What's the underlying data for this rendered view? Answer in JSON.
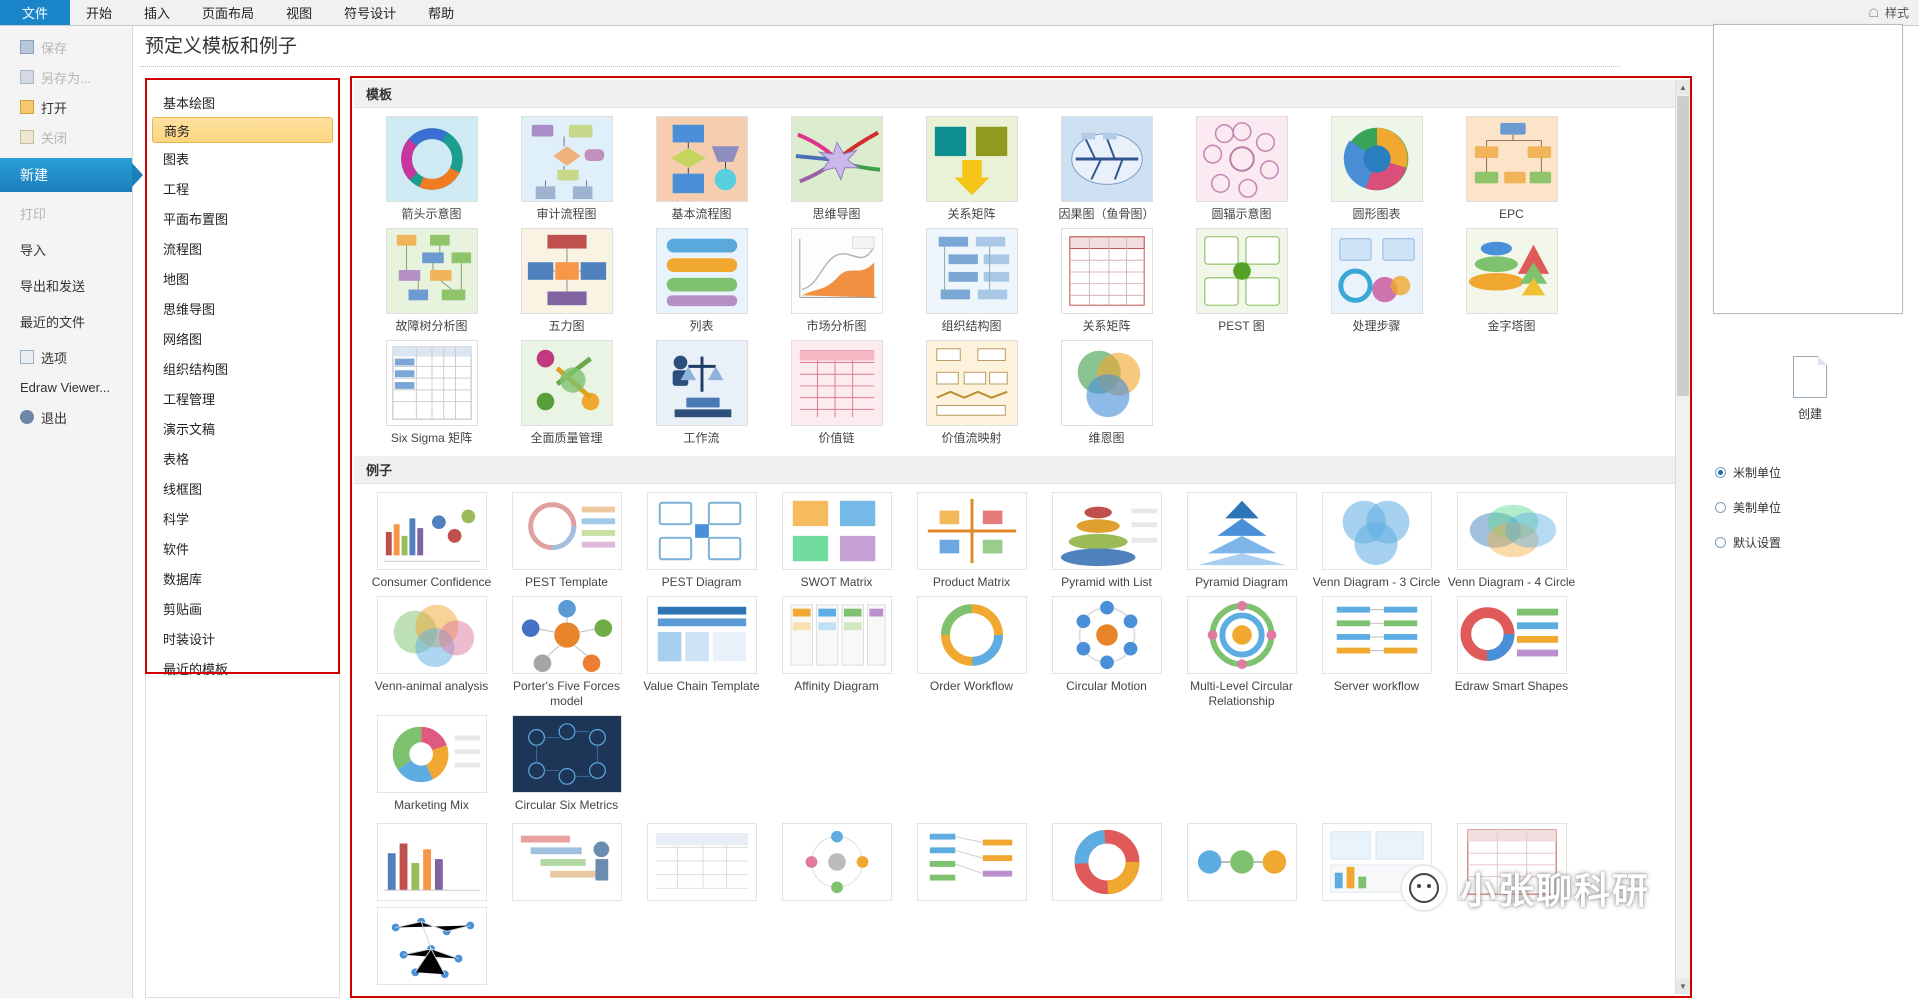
{
  "ribbon": {
    "tabs": [
      {
        "label": "文件",
        "active": true
      },
      {
        "label": "开始",
        "active": false
      },
      {
        "label": "插入",
        "active": false
      },
      {
        "label": "页面布局",
        "active": false
      },
      {
        "label": "视图",
        "active": false
      },
      {
        "label": "符号设计",
        "active": false
      },
      {
        "label": "帮助",
        "active": false
      }
    ],
    "right": {
      "style_label": "样式",
      "home_icon": "home-icon"
    }
  },
  "backstage": {
    "items": [
      {
        "label": "保存",
        "icon": "save-icon",
        "state": "disabled"
      },
      {
        "label": "另存为...",
        "icon": "save-as-icon",
        "state": "disabled"
      },
      {
        "label": "打开",
        "icon": "open-folder-icon",
        "state": "normal"
      },
      {
        "label": "关闭",
        "icon": "close-folder-icon",
        "state": "disabled"
      },
      {
        "label": "新建",
        "icon": "",
        "state": "selected"
      },
      {
        "label": "打印",
        "icon": "",
        "state": "disabled"
      },
      {
        "label": "导入",
        "icon": "",
        "state": "normal"
      },
      {
        "label": "导出和发送",
        "icon": "",
        "state": "normal"
      },
      {
        "label": "最近的文件",
        "icon": "",
        "state": "normal"
      },
      {
        "label": "选项",
        "icon": "options-icon",
        "state": "normal"
      },
      {
        "label": "Edraw Viewer...",
        "icon": "",
        "state": "normal"
      },
      {
        "label": "退出",
        "icon": "exit-icon",
        "state": "normal"
      }
    ]
  },
  "page_title": "预定义模板和例子",
  "categories": [
    {
      "label": "基本绘图",
      "selected": false
    },
    {
      "label": "商务",
      "selected": true
    },
    {
      "label": "图表",
      "selected": false
    },
    {
      "label": "工程",
      "selected": false
    },
    {
      "label": "平面布置图",
      "selected": false
    },
    {
      "label": "流程图",
      "selected": false
    },
    {
      "label": "地图",
      "selected": false
    },
    {
      "label": "思维导图",
      "selected": false
    },
    {
      "label": "网络图",
      "selected": false
    },
    {
      "label": "组织结构图",
      "selected": false
    },
    {
      "label": "工程管理",
      "selected": false
    },
    {
      "label": "演示文稿",
      "selected": false
    },
    {
      "label": "表格",
      "selected": false
    },
    {
      "label": "线框图",
      "selected": false
    },
    {
      "label": "科学",
      "selected": false
    },
    {
      "label": "软件",
      "selected": false
    },
    {
      "label": "数据库",
      "selected": false
    },
    {
      "label": "剪贴画",
      "selected": false
    },
    {
      "label": "时装设计",
      "selected": false
    },
    {
      "label": "最近的模板",
      "selected": false
    }
  ],
  "gallery": {
    "templates_heading": "模板",
    "examples_heading": "例子",
    "templates": [
      {
        "label": "箭头示意图",
        "thumb": "circular-arrows"
      },
      {
        "label": "审计流程图",
        "thumb": "audit-flowchart"
      },
      {
        "label": "基本流程图",
        "thumb": "basic-flowchart"
      },
      {
        "label": "思维导图",
        "thumb": "mind-map"
      },
      {
        "label": "关系矩阵",
        "thumb": "relation-matrix"
      },
      {
        "label": "因果图（鱼骨图）",
        "thumb": "fishbone"
      },
      {
        "label": "圆辐示意图",
        "thumb": "radial-circle"
      },
      {
        "label": "圆形图表",
        "thumb": "circular-chart"
      },
      {
        "label": "EPC",
        "thumb": "epc-diagram"
      },
      {
        "label": "故障树分析图",
        "thumb": "fault-tree"
      },
      {
        "label": "五力图",
        "thumb": "five-forces"
      },
      {
        "label": "列表",
        "thumb": "list-blocks"
      },
      {
        "label": "市场分析图",
        "thumb": "market-analysis"
      },
      {
        "label": "组织结构图",
        "thumb": "org-chart"
      },
      {
        "label": "关系矩阵",
        "thumb": "relation-grid"
      },
      {
        "label": "PEST 图",
        "thumb": "pest-boxes"
      },
      {
        "label": "处理步骤",
        "thumb": "process-steps"
      },
      {
        "label": "金字塔图",
        "thumb": "pyramid"
      },
      {
        "label": "Six Sigma 矩阵",
        "thumb": "six-sigma-matrix"
      },
      {
        "label": "全面质量管理",
        "thumb": "tqm"
      },
      {
        "label": "工作流",
        "thumb": "workflow-people"
      },
      {
        "label": "价值链",
        "thumb": "value-chain"
      },
      {
        "label": "价值流映射",
        "thumb": "value-stream-map"
      },
      {
        "label": "维恩图",
        "thumb": "venn"
      }
    ],
    "examples": [
      {
        "label": "Consumer Confidence",
        "thumb": "consumer-confidence"
      },
      {
        "label": "PEST Template",
        "thumb": "pest-template"
      },
      {
        "label": "PEST Diagram",
        "thumb": "pest-diagram"
      },
      {
        "label": "SWOT Matrix",
        "thumb": "swot-matrix"
      },
      {
        "label": "Product Matrix",
        "thumb": "product-matrix"
      },
      {
        "label": "Pyramid with List",
        "thumb": "pyramid-with-list"
      },
      {
        "label": "Pyramid Diagram",
        "thumb": "pyramid-diagram"
      },
      {
        "label": "Venn Diagram - 3 Circle",
        "thumb": "venn-3"
      },
      {
        "label": "Venn Diagram - 4 Circle",
        "thumb": "venn-4"
      },
      {
        "label": "Venn-animal analysis",
        "thumb": "venn-animal"
      },
      {
        "label": "Porter's Five Forces model",
        "thumb": "porters-five-forces"
      },
      {
        "label": "Value Chain Template",
        "thumb": "value-chain-template"
      },
      {
        "label": "Affinity Diagram",
        "thumb": "affinity-diagram"
      },
      {
        "label": "Order Workflow",
        "thumb": "order-workflow"
      },
      {
        "label": "Circular Motion",
        "thumb": "circular-motion"
      },
      {
        "label": "Multi-Level Circular Relationship",
        "thumb": "multi-level-circular"
      },
      {
        "label": "Server workflow",
        "thumb": "server-workflow"
      },
      {
        "label": "Edraw Smart Shapes",
        "thumb": "edraw-smart-shapes"
      },
      {
        "label": "Marketing Mix",
        "thumb": "marketing-mix"
      },
      {
        "label": "Circular Six Metrics",
        "thumb": "circular-six-metrics"
      }
    ],
    "examples_row3": [
      {
        "thumb": "bar-chart-example"
      },
      {
        "thumb": "gantt-people-example"
      },
      {
        "thumb": "table-list-example"
      },
      {
        "thumb": "circle-dots-example"
      },
      {
        "thumb": "tree-lines-example"
      },
      {
        "thumb": "donut-segments-example"
      },
      {
        "thumb": "process-chain-example"
      },
      {
        "thumb": "dashboard-example"
      },
      {
        "thumb": "red-table-example"
      },
      {
        "thumb": "network-dots-example"
      }
    ]
  },
  "right_pane": {
    "create_label": "创建",
    "create_icon": "new-document-icon",
    "units": [
      {
        "label": "米制单位",
        "selected": true
      },
      {
        "label": "美制单位",
        "selected": false
      },
      {
        "label": "默认设置",
        "selected": false
      }
    ]
  },
  "watermark": {
    "text": "小张聊科研",
    "logo": "panda-avatar-icon"
  },
  "colors": {
    "accent": "#1a85c8",
    "highlight": "#fcd580",
    "redbox": "#d00000",
    "selected_backstage": "#1b7fba"
  }
}
